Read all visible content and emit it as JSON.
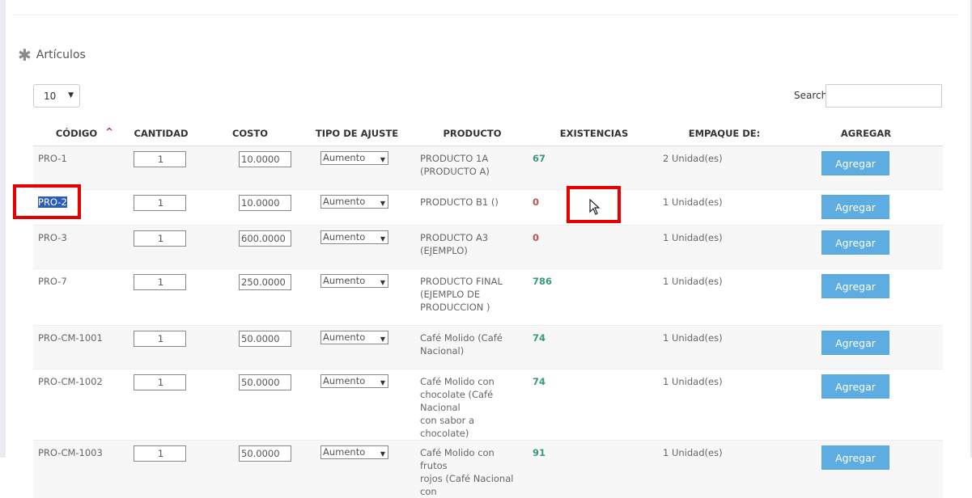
{
  "section": {
    "title": "Artículos",
    "icon": "asterisk-icon"
  },
  "controls": {
    "length_value": "10",
    "search_label": "Search:"
  },
  "table": {
    "headers": [
      "CÓDIGO",
      "CANTIDAD",
      "COSTO",
      "TIPO DE AJUSTE",
      "PRODUCTO",
      "EXISTENCIAS",
      "EMPAQUE DE:",
      "AGREGAR"
    ],
    "rows": [
      {
        "code": "PRO-1",
        "cantidad": "1",
        "costo": "10.0000",
        "tipo": "Aumento",
        "producto": [
          "PRODUCTO 1A",
          "(PRODUCTO A)"
        ],
        "existencias": "67",
        "stock_color": "#3a9a7a",
        "empaque": "2 Unidad(es)",
        "boton": "Agregar"
      },
      {
        "code": "PRO-2",
        "cantidad": "1",
        "costo": "10.0000",
        "tipo": "Aumento",
        "producto": [
          "PRODUCTO B1 ()"
        ],
        "existencias": "0",
        "stock_color": "#c0504d",
        "empaque": "1 Unidad(es)",
        "boton": "Agregar"
      },
      {
        "code": "PRO-3",
        "cantidad": "1",
        "costo": "600.0000",
        "tipo": "Aumento",
        "producto": [
          "PRODUCTO A3",
          "(EJEMPLO)"
        ],
        "existencias": "0",
        "stock_color": "#c0504d",
        "empaque": "1 Unidad(es)",
        "boton": "Agregar"
      },
      {
        "code": "PRO-7",
        "cantidad": "1",
        "costo": "250.0000",
        "tipo": "Aumento",
        "producto": [
          "PRODUCTO FINAL",
          "(EJEMPLO DE",
          "PRODUCCION )"
        ],
        "existencias": "786",
        "stock_color": "#3a9a7a",
        "empaque": "1 Unidad(es)",
        "boton": "Agregar"
      },
      {
        "code": "PRO-CM-1001",
        "cantidad": "1",
        "costo": "50.0000",
        "tipo": "Aumento",
        "producto": [
          "Café Molido (Café",
          "Nacional)"
        ],
        "existencias": "74",
        "stock_color": "#3a9a7a",
        "empaque": "1 Unidad(es)",
        "boton": "Agregar"
      },
      {
        "code": "PRO-CM-1002",
        "cantidad": "1",
        "costo": "50.0000",
        "tipo": "Aumento",
        "producto": [
          "Café Molido con",
          "chocolate (Café Nacional",
          "con sabor a chocolate)"
        ],
        "existencias": "74",
        "stock_color": "#3a9a7a",
        "empaque": "1 Unidad(es)",
        "boton": "Agregar"
      },
      {
        "code": "PRO-CM-1003",
        "cantidad": "1",
        "costo": "50.0000",
        "tipo": "Aumento",
        "producto": [
          "Café Molido con frutos",
          "rojos (Café Nacional con"
        ],
        "existencias": "91",
        "stock_color": "#3a9a7a",
        "empaque": "1 Unidad(es)",
        "boton": "Agregar"
      }
    ]
  },
  "colors": {
    "button": "#5dade2",
    "highlight": "#2b5dbb",
    "annotation": "#e60000"
  }
}
